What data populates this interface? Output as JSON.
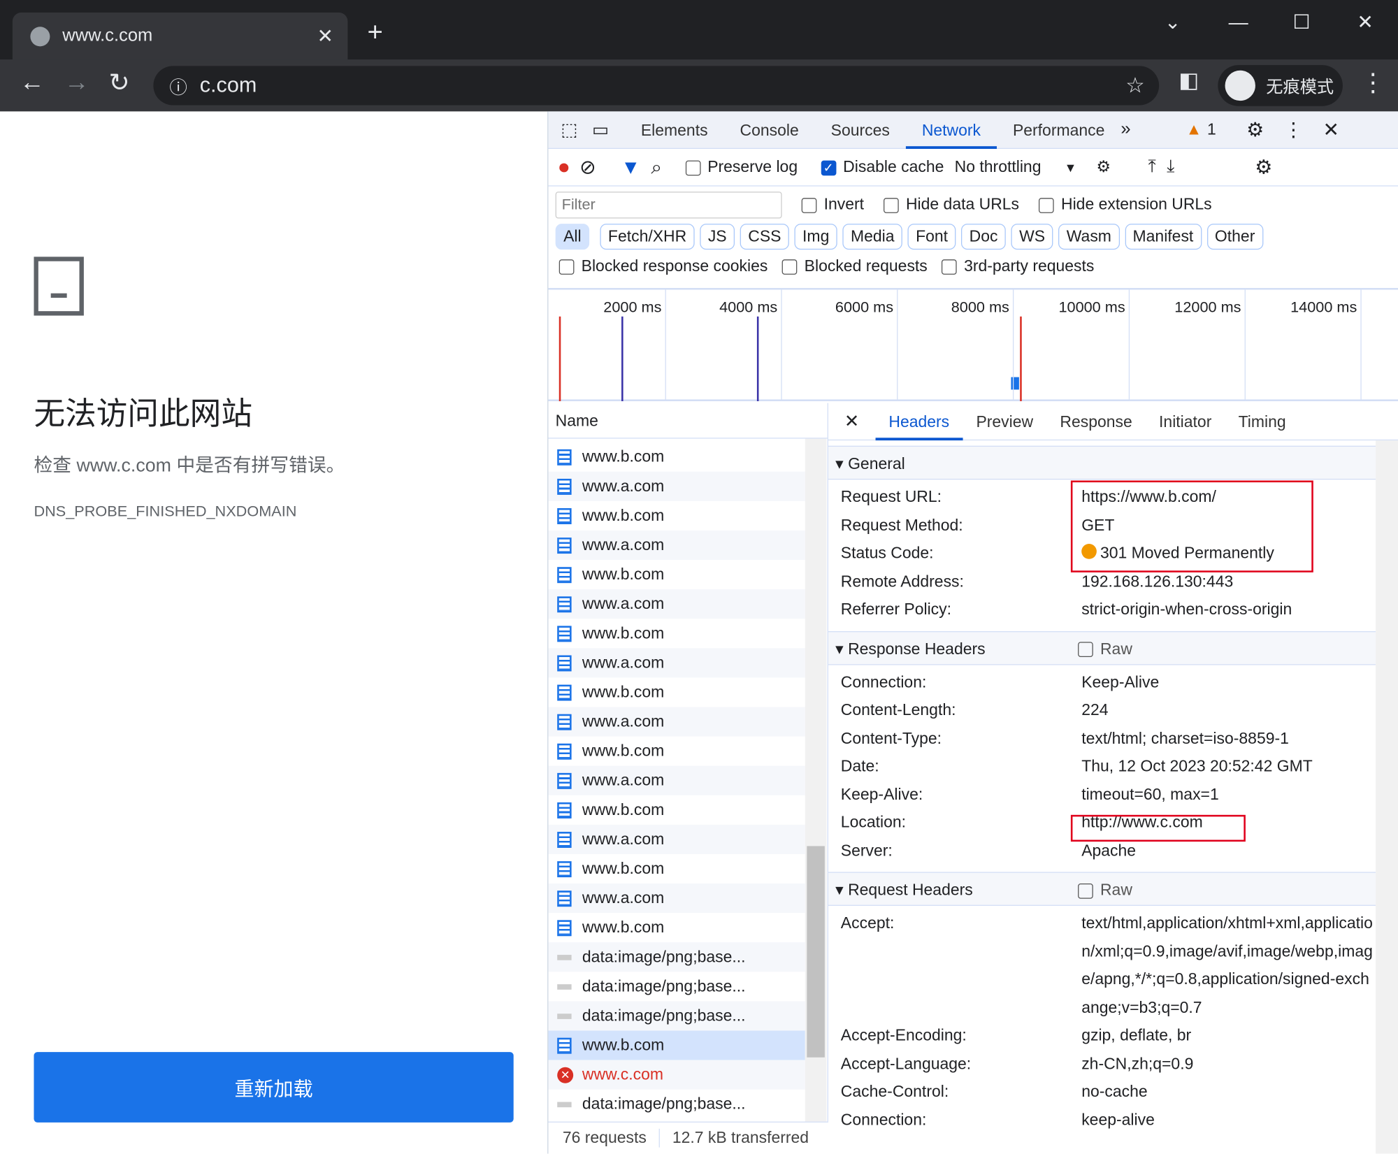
{
  "browser": {
    "tab_title": "www.c.com",
    "url": "c.com",
    "incognito_label": "无痕模式"
  },
  "page": {
    "title": "无法访问此网站",
    "subtitle": "检查 www.c.com 中是否有拼写错误。",
    "error_code": "DNS_PROBE_FINISHED_NXDOMAIN",
    "reload_label": "重新加载"
  },
  "devtools": {
    "tabs": [
      "Elements",
      "Console",
      "Sources",
      "Network",
      "Performance"
    ],
    "active_tab": "Network",
    "warning_count": "1",
    "toolbar": {
      "preserve_log": "Preserve log",
      "disable_cache": "Disable cache",
      "disable_cache_checked": true,
      "throttling": "No throttling"
    },
    "filter": {
      "placeholder": "Filter",
      "invert": "Invert",
      "hide_data": "Hide data URLs",
      "hide_ext": "Hide extension URLs"
    },
    "types": [
      "All",
      "Fetch/XHR",
      "JS",
      "CSS",
      "Img",
      "Media",
      "Font",
      "Doc",
      "WS",
      "Wasm",
      "Manifest",
      "Other"
    ],
    "blocked": [
      "Blocked response cookies",
      "Blocked requests",
      "3rd-party requests"
    ],
    "timeline_ticks": [
      "2000 ms",
      "4000 ms",
      "6000 ms",
      "8000 ms",
      "10000 ms",
      "12000 ms",
      "14000 ms"
    ],
    "list": {
      "header": "Name",
      "rows": [
        {
          "name": "www.b.com",
          "type": "doc"
        },
        {
          "name": "www.a.com",
          "type": "doc"
        },
        {
          "name": "www.b.com",
          "type": "doc"
        },
        {
          "name": "www.a.com",
          "type": "doc"
        },
        {
          "name": "www.b.com",
          "type": "doc"
        },
        {
          "name": "www.a.com",
          "type": "doc"
        },
        {
          "name": "www.b.com",
          "type": "doc"
        },
        {
          "name": "www.a.com",
          "type": "doc"
        },
        {
          "name": "www.b.com",
          "type": "doc"
        },
        {
          "name": "www.a.com",
          "type": "doc"
        },
        {
          "name": "www.b.com",
          "type": "doc"
        },
        {
          "name": "www.a.com",
          "type": "doc"
        },
        {
          "name": "www.b.com",
          "type": "doc"
        },
        {
          "name": "www.a.com",
          "type": "doc"
        },
        {
          "name": "www.b.com",
          "type": "doc"
        },
        {
          "name": "www.a.com",
          "type": "doc"
        },
        {
          "name": "www.b.com",
          "type": "doc"
        },
        {
          "name": "data:image/png;base...",
          "type": "img"
        },
        {
          "name": "data:image/png;base...",
          "type": "img"
        },
        {
          "name": "data:image/png;base...",
          "type": "img"
        },
        {
          "name": "www.b.com",
          "type": "doc",
          "selected": true
        },
        {
          "name": "www.c.com",
          "type": "error"
        },
        {
          "name": "data:image/png;base...",
          "type": "img"
        }
      ]
    },
    "status": {
      "requests": "76 requests",
      "transferred": "12.7 kB transferred"
    },
    "details": {
      "tabs": [
        "Headers",
        "Preview",
        "Response",
        "Initiator",
        "Timing"
      ],
      "active_tab": "Headers",
      "general_title": "General",
      "general": [
        [
          "Request URL:",
          "https://www.b.com/"
        ],
        [
          "Request Method:",
          "GET"
        ],
        [
          "Status Code:",
          "301 Moved Permanently"
        ],
        [
          "Remote Address:",
          "192.168.126.130:443"
        ],
        [
          "Referrer Policy:",
          "strict-origin-when-cross-origin"
        ]
      ],
      "response_title": "Response Headers",
      "raw": "Raw",
      "response": [
        [
          "Connection:",
          "Keep-Alive"
        ],
        [
          "Content-Length:",
          "224"
        ],
        [
          "Content-Type:",
          "text/html; charset=iso-8859-1"
        ],
        [
          "Date:",
          "Thu, 12 Oct 2023 20:52:42 GMT"
        ],
        [
          "Keep-Alive:",
          "timeout=60, max=1"
        ],
        [
          "Location:",
          "http://www.c.com"
        ],
        [
          "Server:",
          "Apache"
        ]
      ],
      "request_title": "Request Headers",
      "request": [
        [
          "Accept:",
          "text/html,application/xhtml+xml,application/xml;q=0.9,image/avif,image/webp,image/apng,*/*;q=0.8,application/signed-exchange;v=b3;q=0.7"
        ],
        [
          "Accept-Encoding:",
          "gzip, deflate, br"
        ],
        [
          "Accept-Language:",
          "zh-CN,zh;q=0.9"
        ],
        [
          "Cache-Control:",
          "no-cache"
        ],
        [
          "Connection:",
          "keep-alive"
        ]
      ]
    }
  },
  "colors": {
    "accent": "#0b57d0",
    "error": "#d93025",
    "status_301": "#f29900",
    "highlight_box": "#e0001b"
  }
}
